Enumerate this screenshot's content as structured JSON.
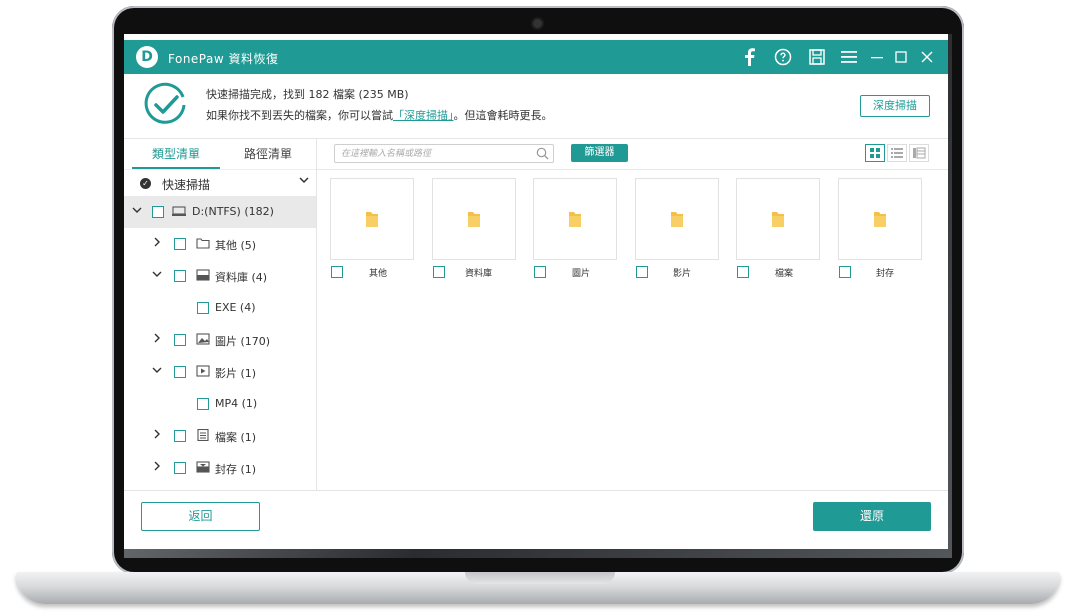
{
  "app": {
    "title": "FonePaw 資料恢復",
    "logo_letter": "D",
    "accent_color": "#1f9a94"
  },
  "titlebar": {
    "icons": [
      "facebook-icon",
      "feedback-icon",
      "save-icon",
      "menu-icon",
      "minimize-icon",
      "maximize-icon",
      "close-icon"
    ]
  },
  "status": {
    "line1": "快速掃描完成，找到 182 檔案 (235 MB)",
    "line2_prefix": "如果你找不到丟失的檔案，你可以嘗試",
    "line2_link": "「深度掃描」",
    "line2_suffix": "。但這會耗時更長。",
    "deep_scan_button": "深度掃描"
  },
  "sidebar": {
    "tabs": [
      {
        "label": "類型清單",
        "active": true
      },
      {
        "label": "路徑清單",
        "active": false
      }
    ],
    "quick_scan_label": "快速掃描",
    "tree": [
      {
        "label": "D:(NTFS) (182)",
        "icon": "drive-icon",
        "expanded": true,
        "selected": true
      },
      {
        "label": "其他 (5)",
        "icon": "folder-icon",
        "expanded": false
      },
      {
        "label": "資料庫  (4)",
        "icon": "database-icon",
        "expanded": true
      },
      {
        "label": "EXE (4)",
        "icon": null,
        "expanded": null
      },
      {
        "label": "圖片 (170)",
        "icon": "image-icon",
        "expanded": false
      },
      {
        "label": "影片 (1)",
        "icon": "video-icon",
        "expanded": true
      },
      {
        "label": "MP4 (1)",
        "icon": null,
        "expanded": null
      },
      {
        "label": "檔案 (1)",
        "icon": "document-icon",
        "expanded": false
      },
      {
        "label": "封存 (1)",
        "icon": "archive-icon",
        "expanded": false
      }
    ]
  },
  "main": {
    "search_placeholder": "在這裡輸入名稱或路徑",
    "filter_button": "篩選器",
    "view_modes": [
      "grid-view-icon",
      "list-view-icon",
      "detail-view-icon"
    ],
    "active_view": "grid-view-icon",
    "folders": [
      {
        "label": "其他"
      },
      {
        "label": "資料庫"
      },
      {
        "label": "圖片"
      },
      {
        "label": "影片"
      },
      {
        "label": "檔案"
      },
      {
        "label": "封存"
      }
    ]
  },
  "bottom": {
    "back_button": "返回",
    "restore_button": "還原"
  }
}
